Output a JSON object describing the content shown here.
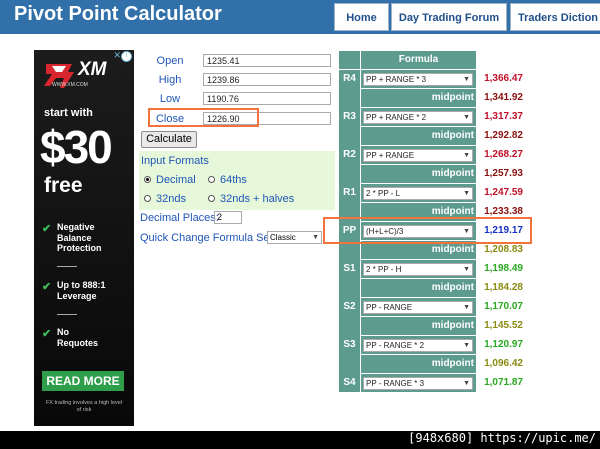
{
  "header": {
    "site_title": "Pivot Point Calculator",
    "nav": [
      "Home",
      "Day Trading Forum",
      "Traders Diction"
    ]
  },
  "ad": {
    "logo_text": "XM",
    "logo_url": "WWW.XM.COM",
    "start_text": "start with",
    "amount": "$30",
    "free_text": "free",
    "features": [
      "Negative Balance Protection",
      "Up to 888:1 Leverage",
      "No Requotes"
    ],
    "cta": "READ MORE",
    "disclaimer": "FX trading involves a high level of risk"
  },
  "inputs": {
    "open_label": "Open",
    "open_value": "1235.41",
    "high_label": "High",
    "high_value": "1239.86",
    "low_label": "Low",
    "low_value": "1190.76",
    "close_label": "Close",
    "close_value": "1226.90"
  },
  "calculate_label": "Calculate",
  "formats": {
    "title": "Input Formats",
    "options": [
      "Decimal",
      "64ths",
      "32nds",
      "32nds + halves"
    ],
    "selected": "Decimal"
  },
  "decimals": {
    "label": "Decimal Places:",
    "value": "2"
  },
  "quick_change": {
    "label": "Quick Change Formula Set:",
    "value": "Classic"
  },
  "formula_header": "Formula",
  "midpoint_label": "midpoint",
  "levels": [
    {
      "label": "R4",
      "formula": "PP + RANGE * 3",
      "value": "1,366.47",
      "color": "#c0102a"
    },
    {
      "label": "R3",
      "formula": "PP + RANGE * 2",
      "value": "1,317.37",
      "color": "#c0102a"
    },
    {
      "label": "R2",
      "formula": "PP + RANGE",
      "value": "1,268.27",
      "color": "#c0102a"
    },
    {
      "label": "R1",
      "formula": "2 * PP - L",
      "value": "1,247.59",
      "color": "#c0102a"
    },
    {
      "label": "PP",
      "formula": "(H+L+C)/3",
      "value": "1,219.17",
      "color": "#1530c8"
    },
    {
      "label": "S1",
      "formula": "2 * PP - H",
      "value": "1,198.49",
      "color": "#2aa820"
    },
    {
      "label": "S2",
      "formula": "PP - RANGE",
      "value": "1,170.07",
      "color": "#2aa820"
    },
    {
      "label": "S3",
      "formula": "PP - RANGE * 2",
      "value": "1,120.97",
      "color": "#2aa820"
    },
    {
      "label": "S4",
      "formula": "PP - RANGE * 3",
      "value": "1,071.87",
      "color": "#2aa820"
    }
  ],
  "midpoints": [
    {
      "value": "1,341.92",
      "color": "#8a1010"
    },
    {
      "value": "1,292.82",
      "color": "#8a1010"
    },
    {
      "value": "1,257.93",
      "color": "#8a1010"
    },
    {
      "value": "1,233.38",
      "color": "#8a1010"
    },
    {
      "value": "1,208.83",
      "color": "#8a8a10"
    },
    {
      "value": "1,184.28",
      "color": "#8a8a10"
    },
    {
      "value": "1,145.52",
      "color": "#8a8a10"
    },
    {
      "value": "1,096.42",
      "color": "#8a8a10"
    }
  ],
  "watermark": "[948x680] https://upic.me/"
}
